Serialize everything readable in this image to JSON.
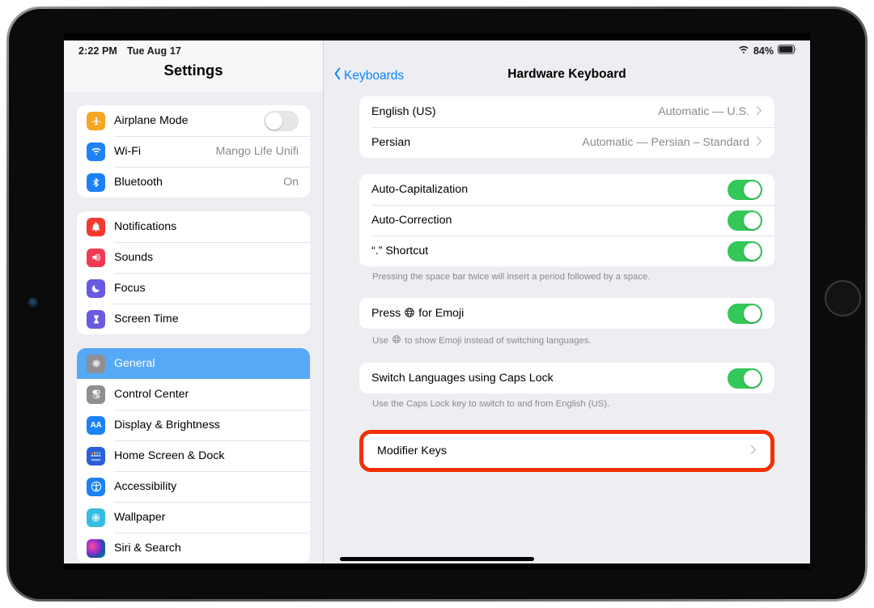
{
  "status_bar": {
    "time": "2:22 PM",
    "date": "Tue Aug 17",
    "wifi_icon": "wifi-icon",
    "battery_percent": "84%",
    "battery_icon": "battery-icon"
  },
  "sidebar": {
    "title": "Settings",
    "groups": [
      {
        "items": [
          {
            "label": "Airplane Mode",
            "icon": "airplane-icon",
            "icon_color": "#f5a623",
            "control": "toggle",
            "toggle_on": false
          },
          {
            "label": "Wi-Fi",
            "icon": "wifi-icon",
            "icon_color": "#1d82f5",
            "control": "value",
            "value": "Mango Life Unifi"
          },
          {
            "label": "Bluetooth",
            "icon": "bluetooth-icon",
            "icon_color": "#1d82f5",
            "control": "value",
            "value": "On"
          }
        ]
      },
      {
        "items": [
          {
            "label": "Notifications",
            "icon": "bell-icon",
            "icon_color": "#f5392f",
            "control": "none",
            "value": ""
          },
          {
            "label": "Sounds",
            "icon": "speaker-icon",
            "icon_color": "#f13a53",
            "control": "none",
            "value": ""
          },
          {
            "label": "Focus",
            "icon": "moon-icon",
            "icon_color": "#6a5ae0",
            "control": "none",
            "value": ""
          },
          {
            "label": "Screen Time",
            "icon": "hourglass-icon",
            "icon_color": "#6a5ae0",
            "control": "none",
            "value": ""
          }
        ]
      },
      {
        "items": [
          {
            "label": "General",
            "icon": "gear-icon",
            "icon_color": "#8e8e93",
            "control": "none",
            "value": "",
            "selected": true
          },
          {
            "label": "Control Center",
            "icon": "control-center-icon",
            "icon_color": "#8e8e93",
            "control": "none",
            "value": ""
          },
          {
            "label": "Display & Brightness",
            "icon": "display-brightness-icon",
            "icon_color": "#1d82f5",
            "control": "none",
            "value": ""
          },
          {
            "label": "Home Screen & Dock",
            "icon": "home-screen-icon",
            "icon_color": "#2b5fd9",
            "control": "none",
            "value": ""
          },
          {
            "label": "Accessibility",
            "icon": "accessibility-icon",
            "icon_color": "#1d82f5",
            "control": "none",
            "value": ""
          },
          {
            "label": "Wallpaper",
            "icon": "wallpaper-icon",
            "icon_color": "#36bce0",
            "control": "none",
            "value": ""
          },
          {
            "label": "Siri & Search",
            "icon": "siri-icon",
            "icon_color": "#2a2a40",
            "control": "none",
            "value": ""
          }
        ]
      }
    ]
  },
  "main": {
    "back_label": "Keyboards",
    "back_icon": "chevron-left-icon",
    "title": "Hardware Keyboard",
    "languages": [
      {
        "label": "English (US)",
        "value": "Automatic — U.S.",
        "chevron": "chevron-right-icon"
      },
      {
        "label": "Persian",
        "value": "Automatic — Persian – Standard",
        "chevron": "chevron-right-icon"
      }
    ],
    "typing_toggles": [
      {
        "label": "Auto-Capitalization",
        "on": true
      },
      {
        "label": "Auto-Correction",
        "on": true
      },
      {
        "label": "“.” Shortcut",
        "on": true
      }
    ],
    "typing_footnote": "Pressing the space bar twice will insert a period followed by a space.",
    "emoji": {
      "label_before": "Press",
      "label_after": "for Emoji",
      "globe_icon": "globe-icon",
      "on": true,
      "footnote_before": "Use",
      "footnote_after": "to show Emoji instead of switching languages."
    },
    "caps_lock": {
      "label": "Switch Languages using Caps Lock",
      "on": true,
      "footnote": "Use the Caps Lock key to switch to and from English (US)."
    },
    "modifier_keys": {
      "label": "Modifier Keys",
      "chevron": "chevron-right-icon",
      "highlight_color": "#f23005"
    }
  },
  "colors": {
    "accent_blue": "#0a84ff",
    "selected_blue": "#56a9f5",
    "toggle_green": "#34c759",
    "highlight_red": "#f23005",
    "screen_bg": "#eeeef2"
  }
}
